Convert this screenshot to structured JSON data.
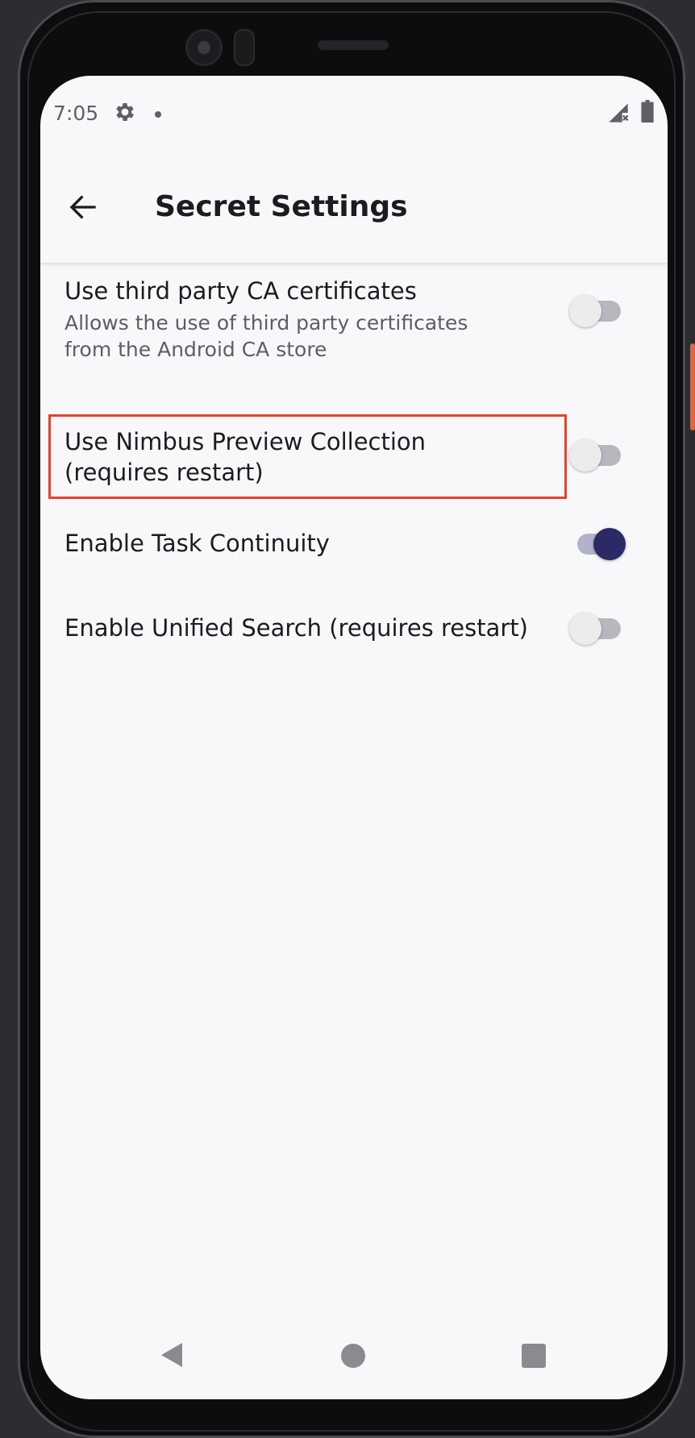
{
  "status_bar": {
    "time": "7:05",
    "icons": [
      "gear-icon",
      "notification-dot-icon",
      "signal-icon",
      "battery-icon"
    ]
  },
  "app_bar": {
    "title": "Secret Settings",
    "back_icon": "arrow-left-icon"
  },
  "preferences": [
    {
      "title": "Use third party CA certificates",
      "summary": "Allows the use of third party certificates from the Android CA store",
      "checked": false
    },
    {
      "title": "Use Nimbus Preview Collection (requires restart)",
      "summary": "",
      "checked": false,
      "highlighted": true
    },
    {
      "title": "Enable Task Continuity",
      "summary": "",
      "checked": true
    },
    {
      "title": "Enable Unified Search (requires restart)",
      "summary": "",
      "checked": false
    }
  ],
  "nav_bar": {
    "icons": [
      "back-triangle-icon",
      "home-circle-icon",
      "recents-square-icon"
    ]
  },
  "colors": {
    "accent": "#2b2a64",
    "highlight": "#e1432e",
    "background": "#f8f8fb"
  }
}
